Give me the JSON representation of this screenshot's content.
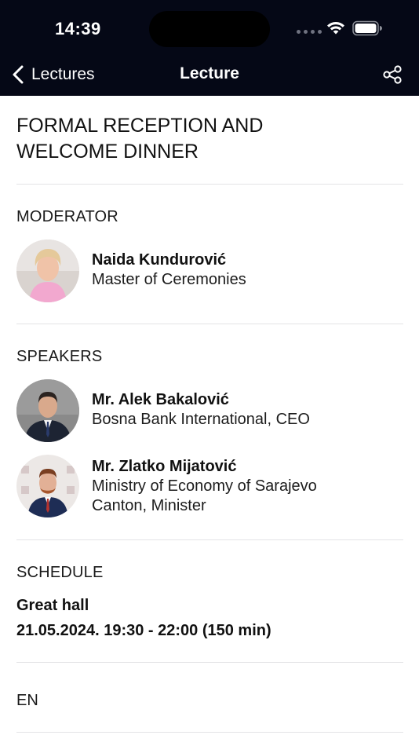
{
  "status_bar": {
    "time": "14:39"
  },
  "nav": {
    "back_label": "Lectures",
    "title": "Lecture",
    "share_icon": "share-icon"
  },
  "lecture": {
    "title": "FORMAL RECEPTION AND WELCOME DINNER"
  },
  "moderator": {
    "section_label": "MODERATOR",
    "people": [
      {
        "name": "Naida Kundurović",
        "role": "Master of Ceremonies"
      }
    ]
  },
  "speakers": {
    "section_label": "SPEAKERS",
    "people": [
      {
        "name": "Mr. Alek Bakalović",
        "role": "Bosna Bank International, CEO"
      },
      {
        "name": "Mr. Zlatko Mijatović",
        "role": "Ministry of Economy of Sarajevo Canton, Minister"
      }
    ]
  },
  "schedule": {
    "section_label": "SCHEDULE",
    "place": "Great hall",
    "time": "21.05.2024. 19:30 - 22:00 (150 min)"
  },
  "language": {
    "label": "EN"
  },
  "colors": {
    "nav_background": "#050816",
    "text": "#111111",
    "divider": "#e3e3e6"
  }
}
